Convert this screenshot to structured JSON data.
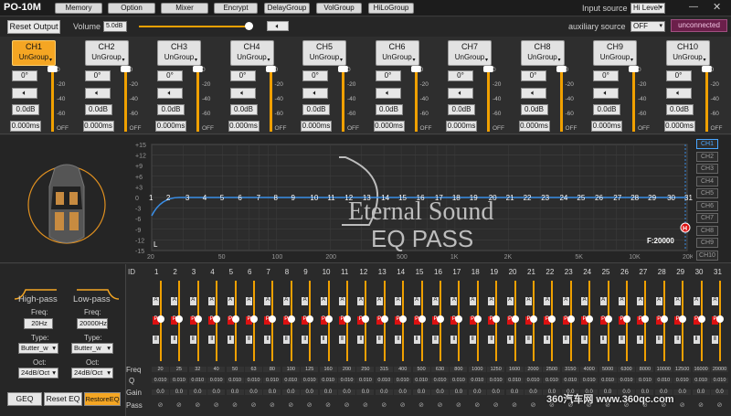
{
  "app": {
    "title": "PO-10M"
  },
  "menu": [
    "Memory",
    "Option",
    "Mixer",
    "Encrypt",
    "DelayGroup",
    "VolGroup",
    "HiLoGroup"
  ],
  "input_source": {
    "label": "Input source",
    "value": "Hi Level"
  },
  "aux_source": {
    "label": "auxiliary source",
    "value": "OFF"
  },
  "status": "unconnected",
  "reset_output": "Reset Output",
  "volume": {
    "label": "Volume",
    "value": "5.0dB",
    "level": 0.92
  },
  "channels": [
    {
      "name": "CH1",
      "group": "UnGroup",
      "phase": "0°",
      "gain": "0.0dB",
      "delay": "0.000ms",
      "active": true
    },
    {
      "name": "CH2",
      "group": "UnGroup",
      "phase": "0°",
      "gain": "0.0dB",
      "delay": "0.000ms",
      "active": false
    },
    {
      "name": "CH3",
      "group": "UnGroup",
      "phase": "0°",
      "gain": "0.0dB",
      "delay": "0.000ms",
      "active": false
    },
    {
      "name": "CH4",
      "group": "UnGroup",
      "phase": "0°",
      "gain": "0.0dB",
      "delay": "0.000ms",
      "active": false
    },
    {
      "name": "CH5",
      "group": "UnGroup",
      "phase": "0°",
      "gain": "0.0dB",
      "delay": "0.000ms",
      "active": false
    },
    {
      "name": "CH6",
      "group": "UnGroup",
      "phase": "0°",
      "gain": "0.0dB",
      "delay": "0.000ms",
      "active": false
    },
    {
      "name": "CH7",
      "group": "UnGroup",
      "phase": "0°",
      "gain": "0.0dB",
      "delay": "0.000ms",
      "active": false
    },
    {
      "name": "CH8",
      "group": "UnGroup",
      "phase": "0°",
      "gain": "0.0dB",
      "delay": "0.000ms",
      "active": false
    },
    {
      "name": "CH9",
      "group": "UnGroup",
      "phase": "0°",
      "gain": "0.0dB",
      "delay": "0.000ms",
      "active": false
    },
    {
      "name": "CH10",
      "group": "UnGroup",
      "phase": "0°",
      "gain": "0.0dB",
      "delay": "0.000ms",
      "active": false
    }
  ],
  "meter_scale": [
    "0",
    "-20",
    "-40",
    "-60",
    "OFF"
  ],
  "graph": {
    "y_ticks": [
      "+15",
      "+12",
      "+9",
      "+6",
      "+3",
      "0",
      "-3",
      "-6",
      "-9",
      "-12",
      "-15"
    ],
    "x_ticks": [
      "20",
      "50",
      "100",
      "200",
      "500",
      "1K",
      "2K",
      "5K",
      "10K",
      "20K"
    ],
    "band_labels": [
      "1",
      "2",
      "3",
      "4",
      "5",
      "6",
      "7",
      "8",
      "9",
      "10",
      "11",
      "12",
      "13",
      "14",
      "15",
      "16",
      "17",
      "18",
      "19",
      "20",
      "21",
      "22",
      "23",
      "24",
      "25",
      "26",
      "27",
      "28",
      "29",
      "30",
      "31"
    ],
    "low_marker": "L",
    "high_marker": "H",
    "freq_readout": "F:20000",
    "logo_line1": "Eternal Sound",
    "logo_line2": "EQ PASS"
  },
  "channel_selector": [
    "CH1",
    "CH2",
    "CH3",
    "CH4",
    "CH5",
    "CH6",
    "CH7",
    "CH8",
    "CH9",
    "CH10"
  ],
  "highpass": {
    "label": "High-pass",
    "freq_label": "Freq:",
    "freq": "20Hz",
    "type_label": "Type:",
    "type": "Butter_w",
    "oct_label": "Oct:",
    "oct": "24dB/Oct"
  },
  "lowpass": {
    "label": "Low-pass",
    "freq_label": "Freq:",
    "freq": "20000Hz",
    "type_label": "Type:",
    "type": "Butter_w",
    "oct_label": "Oct:",
    "oct": "24dB/Oct"
  },
  "buttons": {
    "geq": "GEQ",
    "reset_eq": "Reset EQ",
    "restore_eq": "RestoreEQ"
  },
  "eq_rows": {
    "id": "ID",
    "freq": "Freq",
    "q": "Q",
    "gain": "Gain",
    "pass": "Pass"
  },
  "eq_freqs": [
    "20",
    "25",
    "32",
    "40",
    "50",
    "63",
    "80",
    "100",
    "125",
    "160",
    "200",
    "250",
    "315",
    "400",
    "500",
    "630",
    "800",
    "1000",
    "1250",
    "1600",
    "2000",
    "2500",
    "3150",
    "4000",
    "5000",
    "6300",
    "8000",
    "10000",
    "12500",
    "16000",
    "20000"
  ],
  "eq_q": "0.010",
  "eq_gain": "0.0",
  "eq_pass": "⊘",
  "watermark": "360汽车网 www.360qc.com"
}
